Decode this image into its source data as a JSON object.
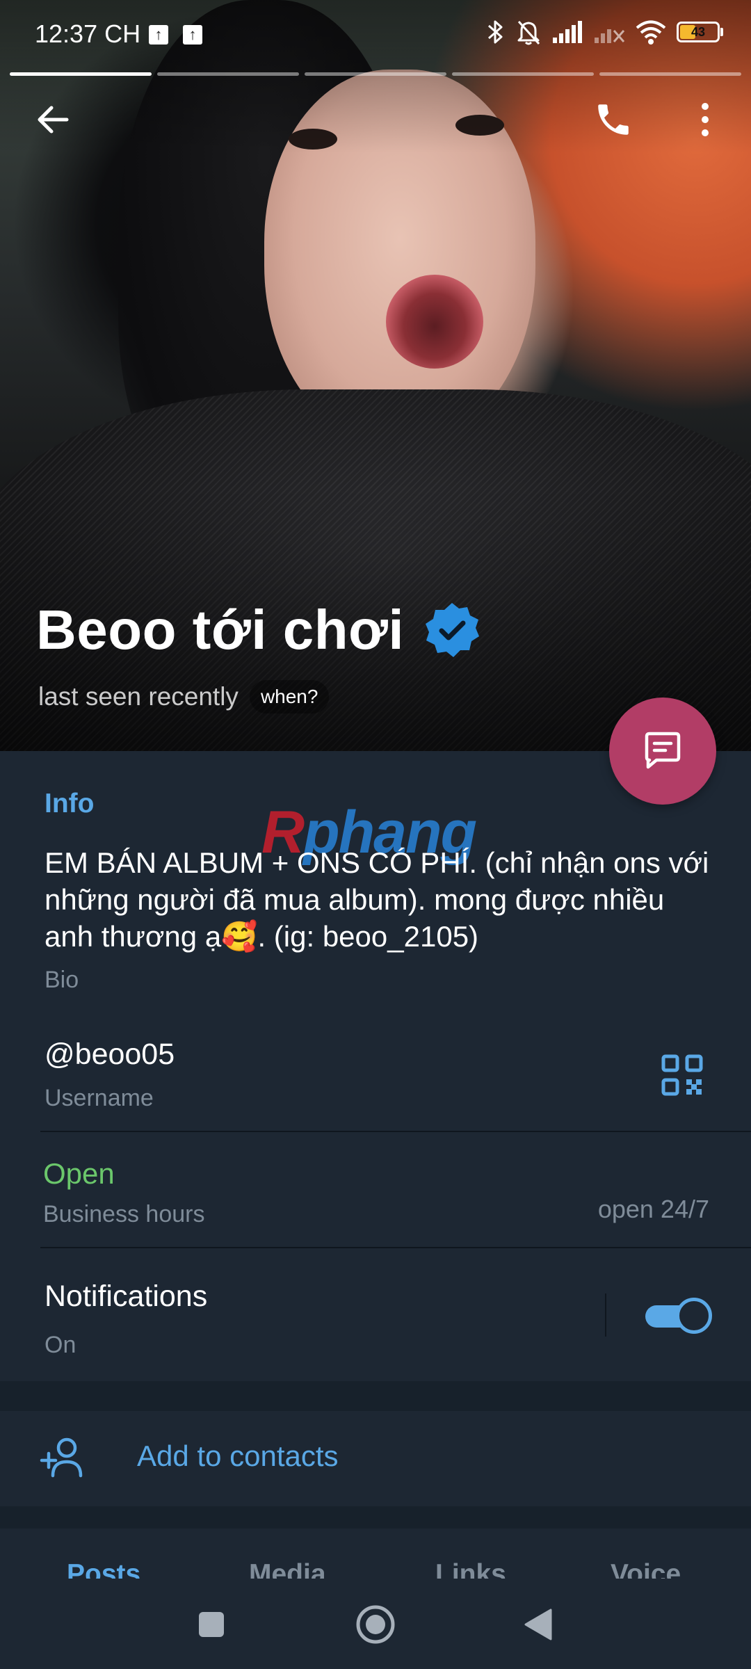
{
  "status_bar": {
    "time": "12:37 CH",
    "battery": "43"
  },
  "profile": {
    "name": "Beoo tới chơi",
    "last_seen": "last seen recently",
    "when_chip": "when?"
  },
  "watermark": {
    "text_a": "R",
    "text_b": "phang"
  },
  "info": {
    "section_title": "Info",
    "bio_text": "EM BÁN ALBUM + ONS CÓ PHÍ. (chỉ nhận ons với những người đã mua album). mong được nhiều anh thương ạ🥰. (ig: beoo_2105)",
    "bio_label": "Bio",
    "username": "@beoo05",
    "username_label": "Username",
    "business_status": "Open",
    "business_label": "Business hours",
    "business_hours": "open 24/7",
    "notifications": "Notifications",
    "notifications_state": "On"
  },
  "contacts": {
    "add_label": "Add to contacts"
  },
  "tabs": [
    {
      "label": "Posts"
    },
    {
      "label": "Media"
    },
    {
      "label": "Links"
    },
    {
      "label": "Voice"
    }
  ],
  "colors": {
    "accent": "#5aa8e6",
    "fab": "#b23d66",
    "open_green": "#6bc76b",
    "card_bg": "#1d2733",
    "page_bg": "#17212b"
  },
  "icons": {
    "back": "arrow-left-icon",
    "call": "phone-icon",
    "more": "more-vertical-icon",
    "verified": "verified-badge-icon",
    "fab": "message-icon",
    "qr": "qr-code-icon",
    "add_contact": "add-person-icon"
  }
}
